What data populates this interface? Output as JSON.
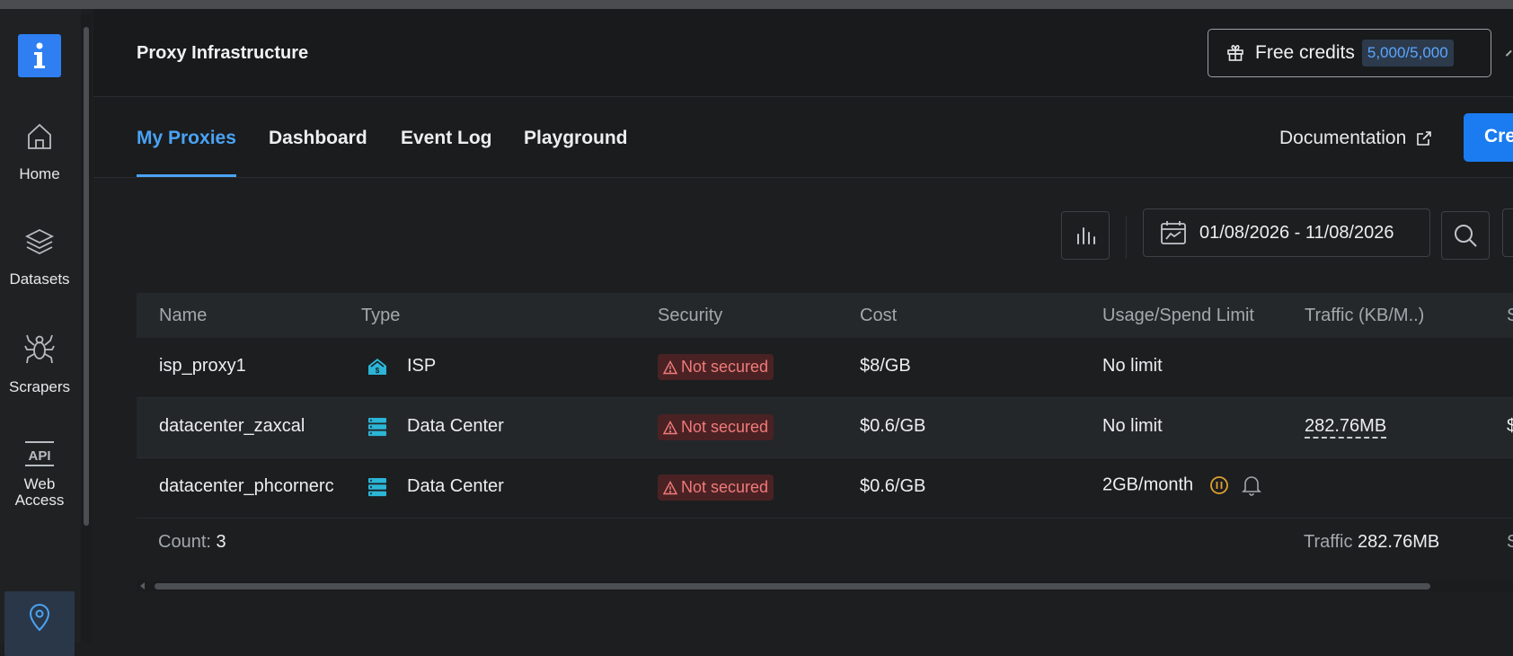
{
  "app": {
    "page_title": "Proxy Infrastructure",
    "logo_icon": "info-icon"
  },
  "credits": {
    "label": "Free credits",
    "value": "5,000/5,000"
  },
  "sidebar": {
    "items": [
      {
        "label": "Home",
        "icon": "home-icon"
      },
      {
        "label": "Datasets",
        "icon": "layers-icon"
      },
      {
        "label": "Scrapers",
        "icon": "spider-icon"
      },
      {
        "label": "Web Access",
        "icon": "api-icon"
      },
      {
        "label": "",
        "icon": "location-pin-icon"
      }
    ]
  },
  "tabs": [
    {
      "label": "My Proxies",
      "active": true
    },
    {
      "label": "Dashboard",
      "active": false
    },
    {
      "label": "Event Log",
      "active": false
    },
    {
      "label": "Playground",
      "active": false
    }
  ],
  "header_actions": {
    "documentation": "Documentation",
    "create_button": "Cre"
  },
  "toolbar": {
    "date_range": "01/08/2026 - 11/08/2026"
  },
  "table": {
    "columns": [
      "Name",
      "Type",
      "Security",
      "Cost",
      "Usage/Spend Limit",
      "Traffic (KB/M..)",
      "S"
    ],
    "rows": [
      {
        "name": "isp_proxy1",
        "type": "ISP",
        "type_icon": "isp-house-icon",
        "security": "Not secured",
        "cost": "$8/GB",
        "limit": "No limit",
        "traffic": "",
        "extra": ""
      },
      {
        "name": "datacenter_zaxcal",
        "type": "Data Center",
        "type_icon": "server-icon",
        "security": "Not secured",
        "cost": "$0.6/GB",
        "limit": "No limit",
        "traffic": "282.76MB",
        "extra": "$"
      },
      {
        "name": "datacenter_phcornerc",
        "type": "Data Center",
        "type_icon": "server-icon",
        "security": "Not secured",
        "cost": "$0.6/GB",
        "limit": "2GB/month",
        "traffic": "",
        "extra": ""
      }
    ],
    "footer": {
      "count_label": "Count:",
      "count_value": "3",
      "traffic_label": "Traffic",
      "traffic_value": "282.76MB",
      "extra": "S"
    }
  },
  "colors": {
    "accent": "#4aa3f5",
    "primary_button": "#1a7cf0",
    "danger_bg": "#4a2224",
    "danger_text": "#f07a7a",
    "warning": "#e0a030"
  }
}
